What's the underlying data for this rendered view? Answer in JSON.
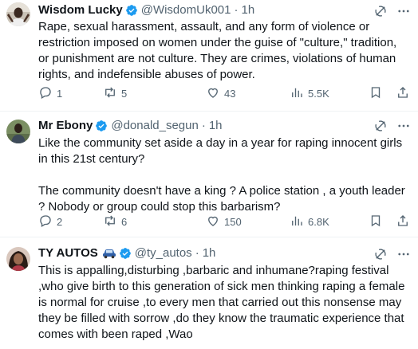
{
  "colors": {
    "text_primary": "#0f1419",
    "text_secondary": "#536471",
    "verified_blue": "#1d9bf0",
    "divider": "#eff3f4"
  },
  "tweets": [
    {
      "name": "Wisdom Lucky",
      "handle": "@WisdomUk001",
      "separator": "·",
      "time": "1h",
      "verified": true,
      "text": "Rape, sexual harassment, assault, and any form of violence or restriction imposed on women under the guise of \"culture,\" tradition, or punishment are not culture. They are crimes, violations of human rights, and indefensible abuses of power.",
      "replies": "1",
      "reposts": "5",
      "likes": "43",
      "views": "5.5K",
      "icons": [
        "grok-icon",
        "more-icon",
        "reply-icon",
        "retweet-icon",
        "like-icon",
        "views-icon",
        "bookmark-icon",
        "share-icon"
      ]
    },
    {
      "name": "Mr Ebony",
      "handle": "@donald_segun",
      "separator": "·",
      "time": "1h",
      "verified": true,
      "text": "Like the community set aside a day in a year for raping innocent girls in this 21st century?\n\nThe community doesn't have a king ? A police station , a youth leader ? Nobody or group could stop this barbarism?",
      "replies": "2",
      "reposts": "6",
      "likes": "150",
      "views": "6.8K"
    },
    {
      "name": "TY AUTOS",
      "handle": "@ty_autos",
      "separator": "·",
      "time": "1h",
      "verified": true,
      "name_emoji": "car-icon",
      "text": "This is appalling,disturbing ,barbaric and inhumane?raping festival ,who give birth to this generation of sick men thinking raping a female is normal for cruise ,to every men that carried out this nonsense may they be filled with sorrow ,do they know the traumatic experience that comes with been raped ,Wao"
    }
  ]
}
